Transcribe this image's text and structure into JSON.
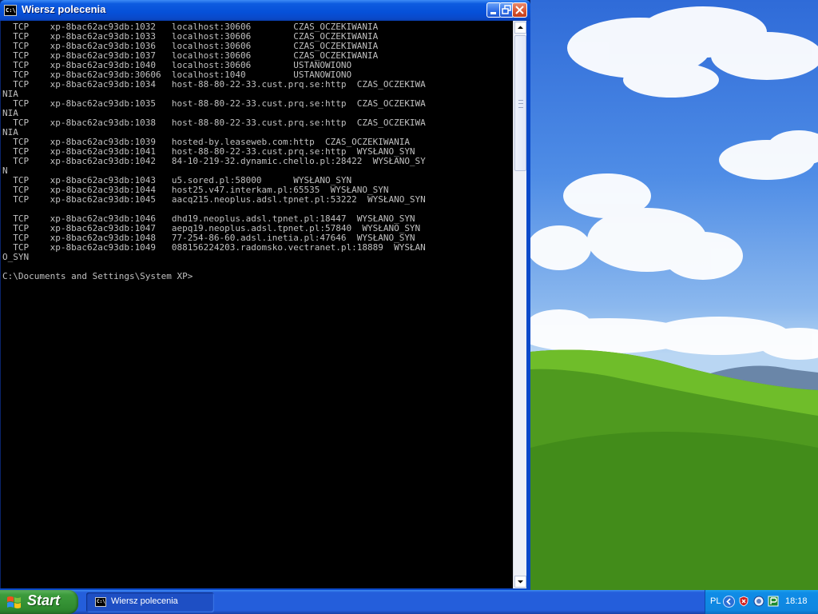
{
  "window": {
    "title": "Wiersz polecenia",
    "icon_text": "C:\\"
  },
  "console": {
    "lines": [
      "  TCP    xp-8bac62ac93db:1032   localhost:30606        CZAS_OCZEKIWANIA",
      "  TCP    xp-8bac62ac93db:1033   localhost:30606        CZAS_OCZEKIWANIA",
      "  TCP    xp-8bac62ac93db:1036   localhost:30606        CZAS_OCZEKIWANIA",
      "  TCP    xp-8bac62ac93db:1037   localhost:30606        CZAS_OCZEKIWANIA",
      "  TCP    xp-8bac62ac93db:1040   localhost:30606        USTANOWIONO",
      "  TCP    xp-8bac62ac93db:30606  localhost:1040         USTANOWIONO",
      "  TCP    xp-8bac62ac93db:1034   host-88-80-22-33.cust.prq.se:http  CZAS_OCZEKIWA",
      "NIA",
      "  TCP    xp-8bac62ac93db:1035   host-88-80-22-33.cust.prq.se:http  CZAS_OCZEKIWA",
      "NIA",
      "  TCP    xp-8bac62ac93db:1038   host-88-80-22-33.cust.prq.se:http  CZAS_OCZEKIWA",
      "NIA",
      "  TCP    xp-8bac62ac93db:1039   hosted-by.leaseweb.com:http  CZAS_OCZEKIWANIA",
      "  TCP    xp-8bac62ac93db:1041   host-88-80-22-33.cust.prq.se:http  WYSŁANO_SYN",
      "  TCP    xp-8bac62ac93db:1042   84-10-219-32.dynamic.chello.pl:28422  WYSŁANO_SY",
      "N",
      "  TCP    xp-8bac62ac93db:1043   u5.sored.pl:58000      WYSŁANO_SYN",
      "  TCP    xp-8bac62ac93db:1044   host25.v47.interkam.pl:65535  WYSŁANO_SYN",
      "  TCP    xp-8bac62ac93db:1045   aacq215.neoplus.adsl.tpnet.pl:53222  WYSŁANO_SYN",
      "",
      "  TCP    xp-8bac62ac93db:1046   dhd19.neoplus.adsl.tpnet.pl:18447  WYSŁANO_SYN",
      "  TCP    xp-8bac62ac93db:1047   aepq19.neoplus.adsl.tpnet.pl:57840  WYSŁANO_SYN",
      "  TCP    xp-8bac62ac93db:1048   77-254-86-60.adsl.inetia.pl:47646  WYSŁANO_SYN",
      "  TCP    xp-8bac62ac93db:1049   088156224203.radomsko.vectranet.pl:18889  WYSŁAN",
      "O_SYN",
      "",
      "C:\\Documents and Settings\\System XP>"
    ]
  },
  "taskbar": {
    "start_label": "Start",
    "task_icon_text": "C:\\",
    "active_task": "Wiersz polecenia",
    "tray": {
      "language": "PL",
      "clock": "18:18"
    }
  },
  "colors": {
    "titlebar": "#0a49c9",
    "console_bg": "#000000",
    "console_text": "#c0c0c0",
    "taskbar": "#245edb",
    "start_button": "#3c9b3c",
    "tray": "#0f86e0"
  }
}
